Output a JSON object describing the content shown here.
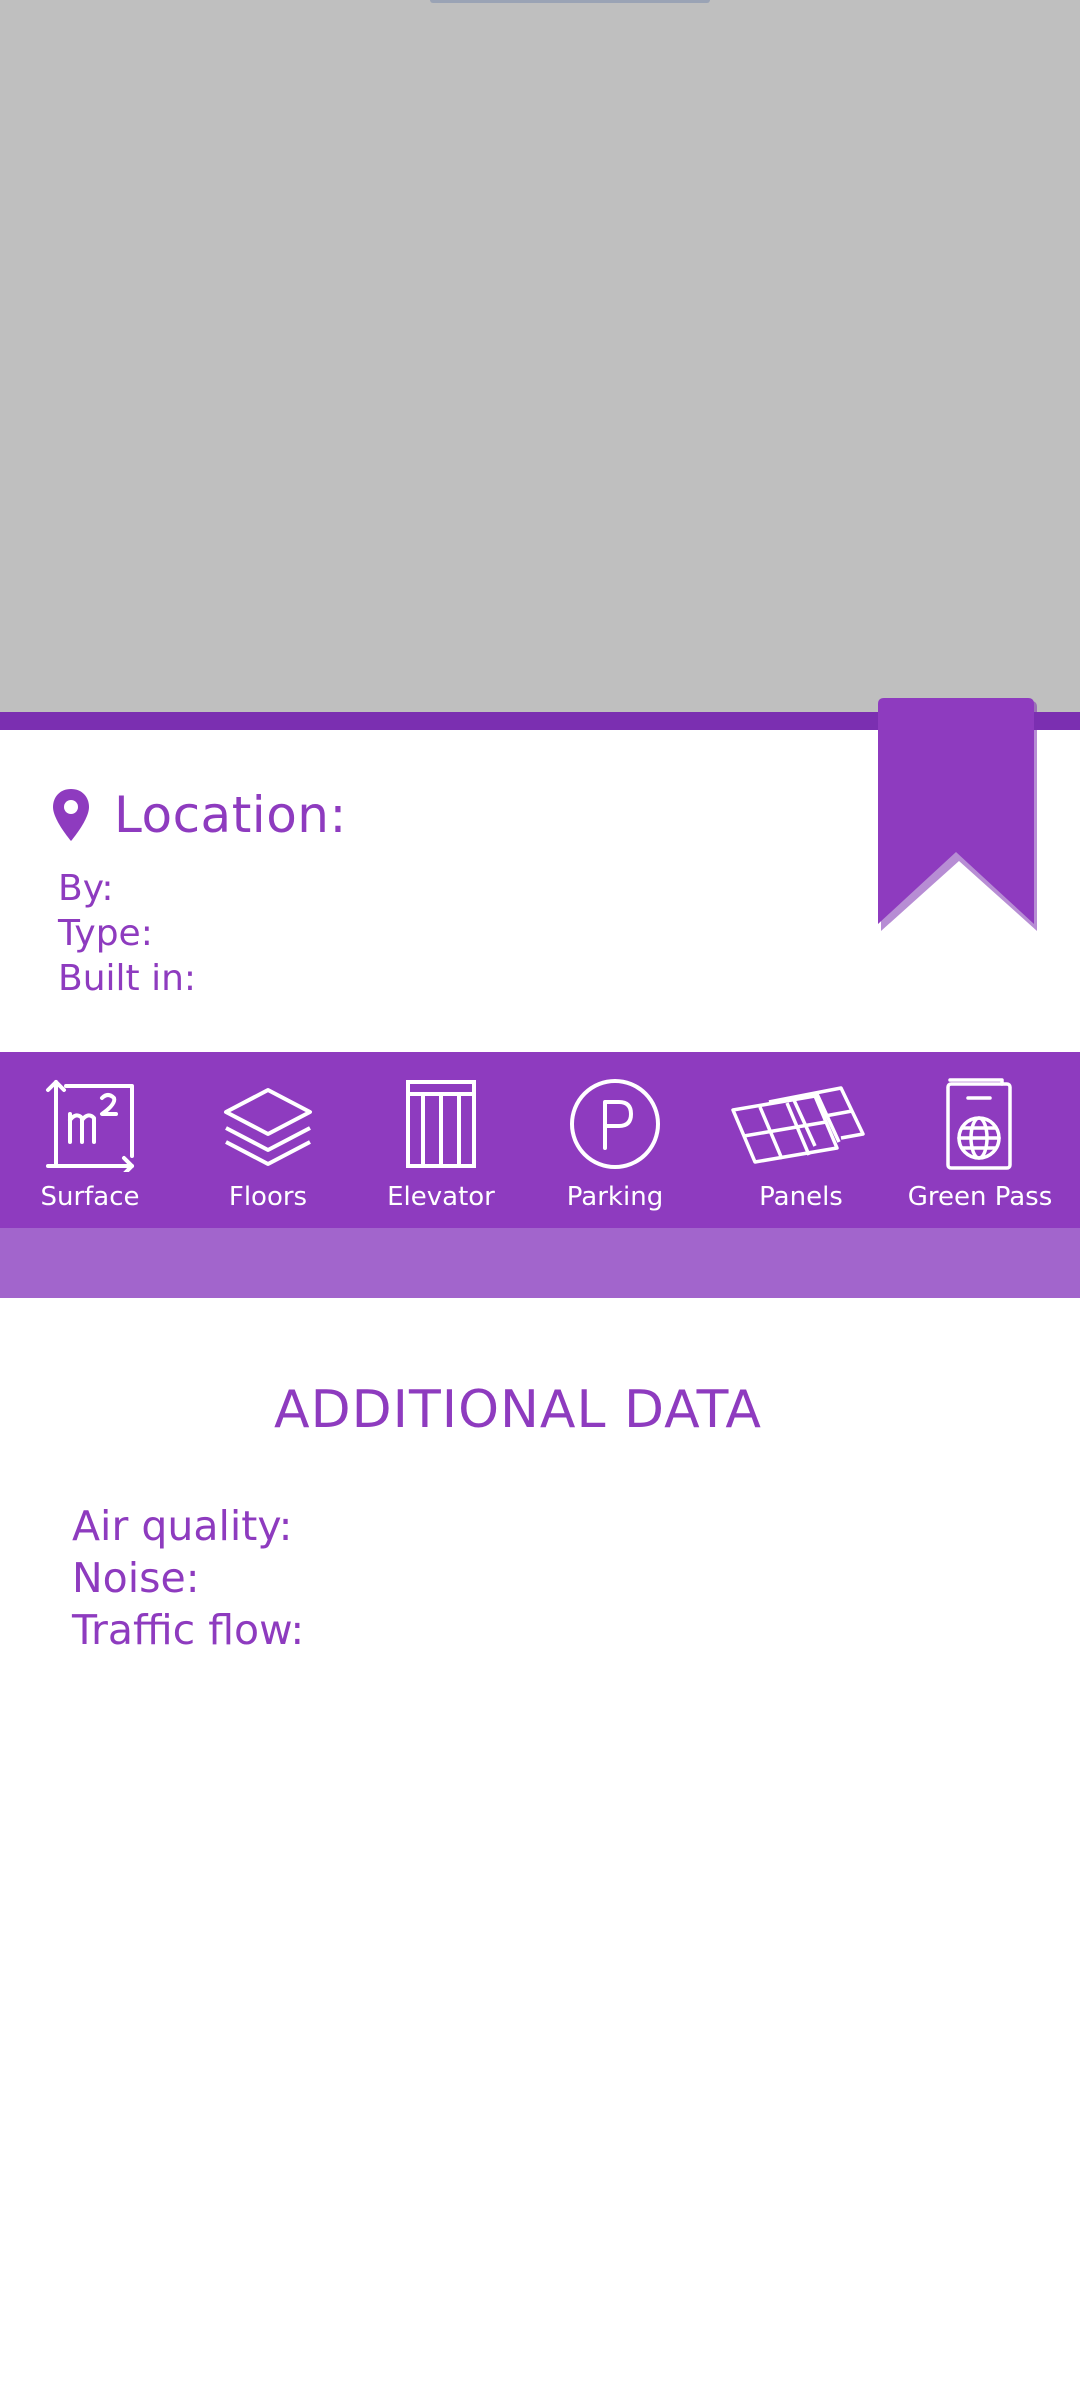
{
  "property": {
    "location_label": "Location:",
    "by_label": "By:",
    "type_label": "Type:",
    "built_label": "Built in:"
  },
  "features": [
    {
      "label": "Surface",
      "icon": "square-meters-icon"
    },
    {
      "label": "Floors",
      "icon": "layers-icon"
    },
    {
      "label": "Elevator",
      "icon": "elevator-icon"
    },
    {
      "label": "Parking",
      "icon": "parking-icon"
    },
    {
      "label": "Panels",
      "icon": "solar-panels-icon"
    },
    {
      "label": "Green Pass",
      "icon": "passport-icon"
    }
  ],
  "additional": {
    "title": "ADDITIONAL DATA",
    "air_quality_label": "Air quality:",
    "noise_label": "Noise:",
    "traffic_label": "Traffic flow:"
  },
  "colors": {
    "primary": "#8e3bbf",
    "stripe": "#7b2fb1",
    "subbar": "#a265cc",
    "image_placeholder": "#bfbfbf"
  }
}
